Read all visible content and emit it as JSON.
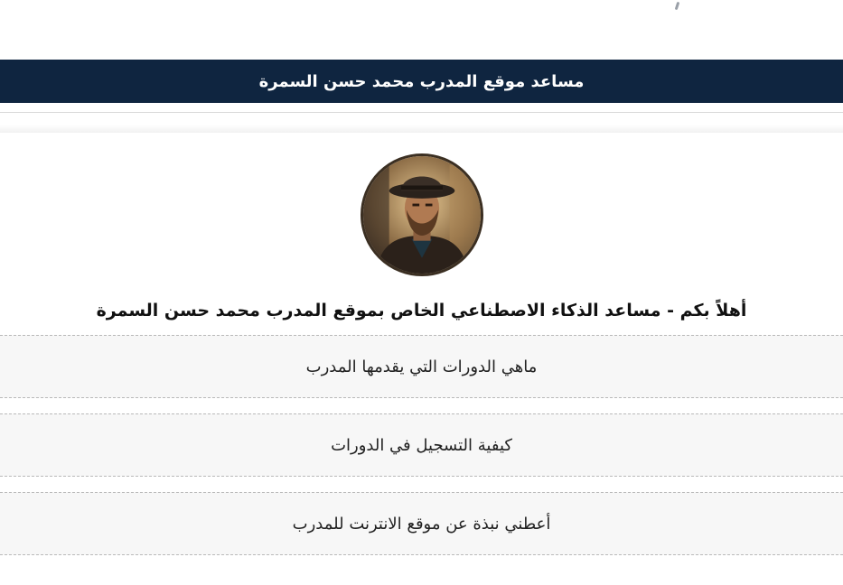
{
  "header": {
    "title": "مساعد موقع المدرب محمد حسن السمرة"
  },
  "assistant": {
    "avatar_icon": "trainer-avatar",
    "welcome": "أهلاً بكم - مساعد الذكاء الاصطناعي الخاص بموقع المدرب محمد حسن السمرة"
  },
  "suggestions": [
    {
      "label": "ماهي الدورات التي يقدمها المدرب"
    },
    {
      "label": "كيفية التسجيل في الدورات"
    },
    {
      "label": "أعطني نبذة عن موقع الانترنت للمدرب"
    }
  ],
  "colors": {
    "header_bg": "#0f2540",
    "suggestion_bg": "#f7f7f7"
  }
}
